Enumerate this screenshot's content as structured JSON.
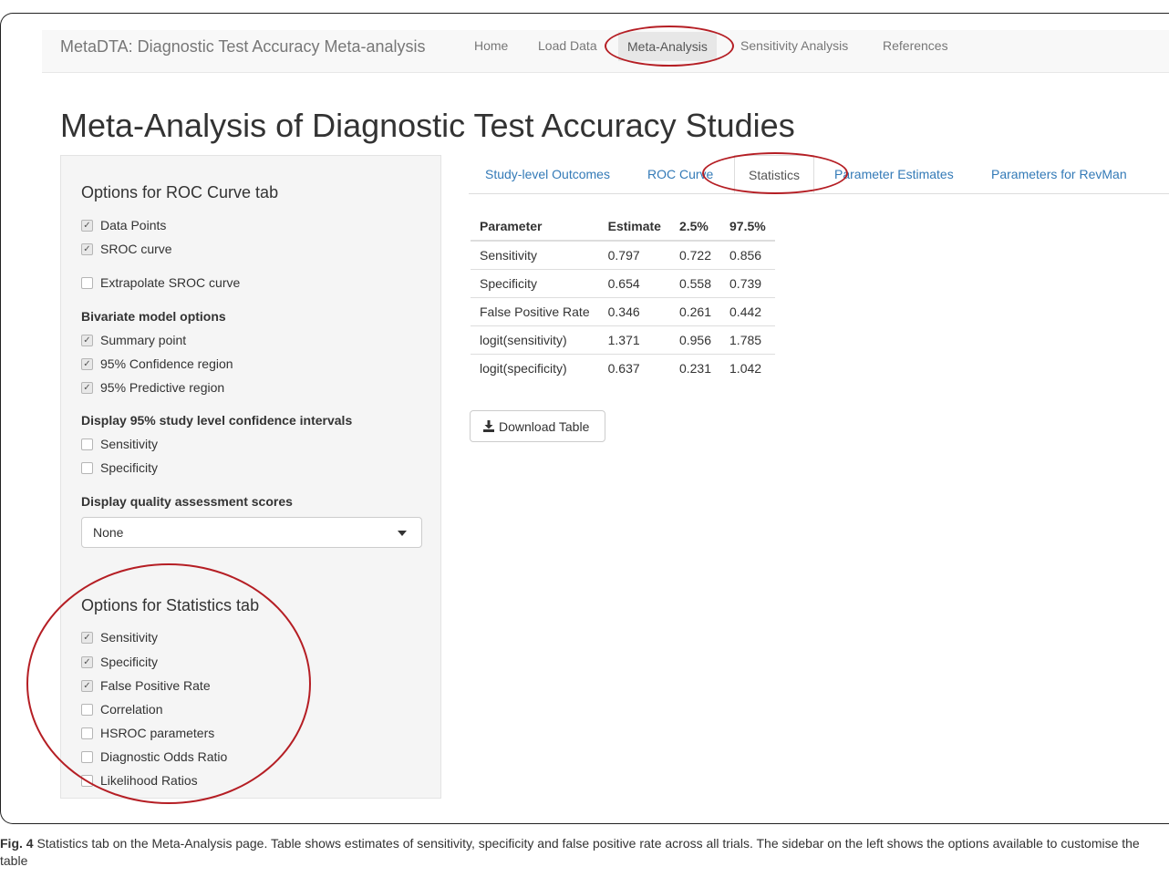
{
  "navbar": {
    "brand": "MetaDTA: Diagnostic Test Accuracy Meta-analysis",
    "links": [
      "Home",
      "Load Data",
      "Meta-Analysis",
      "Sensitivity Analysis",
      "References"
    ],
    "active": "Meta-Analysis"
  },
  "page_title": "Meta-Analysis of Diagnostic Test Accuracy Studies",
  "sidebar": {
    "roc_heading": "Options for ROC Curve tab",
    "roc_options": [
      {
        "label": "Data Points",
        "checked": true
      },
      {
        "label": "SROC curve",
        "checked": true
      },
      {
        "label": "Extrapolate SROC curve",
        "checked": false
      }
    ],
    "bivariate_heading": "Bivariate model options",
    "bivariate_options": [
      {
        "label": "Summary point",
        "checked": true
      },
      {
        "label": "95% Confidence region",
        "checked": true
      },
      {
        "label": "95% Predictive region",
        "checked": true
      }
    ],
    "ci_heading": "Display 95% study level confidence intervals",
    "ci_options": [
      {
        "label": "Sensitivity",
        "checked": false
      },
      {
        "label": "Specificity",
        "checked": false
      }
    ],
    "quality_heading": "Display quality assessment scores",
    "quality_select": "None",
    "stats_heading": "Options for Statistics tab",
    "stats_options": [
      {
        "label": "Sensitivity",
        "checked": true
      },
      {
        "label": "Specificity",
        "checked": true
      },
      {
        "label": "False Positive Rate",
        "checked": true
      },
      {
        "label": "Correlation",
        "checked": false
      },
      {
        "label": "HSROC parameters",
        "checked": false
      },
      {
        "label": "Diagnostic Odds Ratio",
        "checked": false
      },
      {
        "label": "Likelihood Ratios",
        "checked": false
      }
    ]
  },
  "tabs": {
    "items": [
      "Study-level Outcomes",
      "ROC Curve",
      "Statistics",
      "Parameter Estimates",
      "Parameters for RevMan"
    ],
    "active": "Statistics"
  },
  "table": {
    "headers": [
      "Parameter",
      "Estimate",
      "2.5%",
      "97.5%"
    ],
    "rows": [
      [
        "Sensitivity",
        "0.797",
        "0.722",
        "0.856"
      ],
      [
        "Specificity",
        "0.654",
        "0.558",
        "0.739"
      ],
      [
        "False Positive Rate",
        "0.346",
        "0.261",
        "0.442"
      ],
      [
        "logit(sensitivity)",
        "1.371",
        "0.956",
        "1.785"
      ],
      [
        "logit(specificity)",
        "0.637",
        "0.231",
        "1.042"
      ]
    ]
  },
  "download_button": "Download Table",
  "caption": {
    "label": "Fig. 4",
    "text": " Statistics tab on the Meta-Analysis page. Table shows estimates of sensitivity, specificity and false positive rate across all trials. The sidebar on the left shows the options available to customise the table"
  },
  "colors": {
    "highlight_ring": "#b51e24",
    "link": "#337ab7"
  },
  "icons": {
    "download": "download-icon",
    "caret": "caret-down-icon"
  }
}
